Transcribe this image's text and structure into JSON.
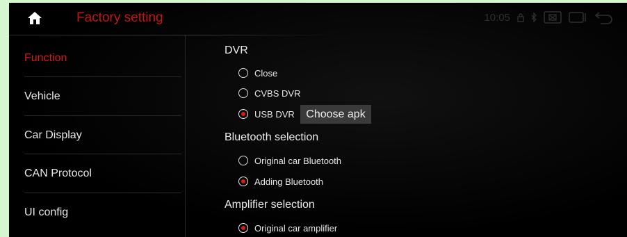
{
  "header": {
    "title": "Factory setting",
    "time": "10:05",
    "icons": [
      "home-icon",
      "lock-icon",
      "bluetooth-icon",
      "screen-mode-icon",
      "window-icon",
      "back-icon"
    ],
    "title_color": "#c41414"
  },
  "sidebar": {
    "items": [
      {
        "label": "Function",
        "active": true
      },
      {
        "label": "Vehicle",
        "active": false
      },
      {
        "label": "Car Display",
        "active": false
      },
      {
        "label": "CAN Protocol",
        "active": false
      },
      {
        "label": "UI config",
        "active": false
      }
    ],
    "active_color": "#d61a1a"
  },
  "content": {
    "dvr": {
      "title": "DVR",
      "options": [
        {
          "label": "Close",
          "selected": false
        },
        {
          "label": "CVBS DVR",
          "selected": false
        },
        {
          "label": "USB DVR",
          "selected": true
        }
      ],
      "choose_button": "Choose apk"
    },
    "bluetooth": {
      "title": "Bluetooth selection",
      "options": [
        {
          "label": "Original car Bluetooth",
          "selected": false
        },
        {
          "label": "Adding Bluetooth",
          "selected": true
        }
      ]
    },
    "amplifier": {
      "title": "Amplifier selection",
      "options": [
        {
          "label": "Original car amplifier",
          "selected": true
        }
      ]
    },
    "radio_accent": "#e01818"
  }
}
